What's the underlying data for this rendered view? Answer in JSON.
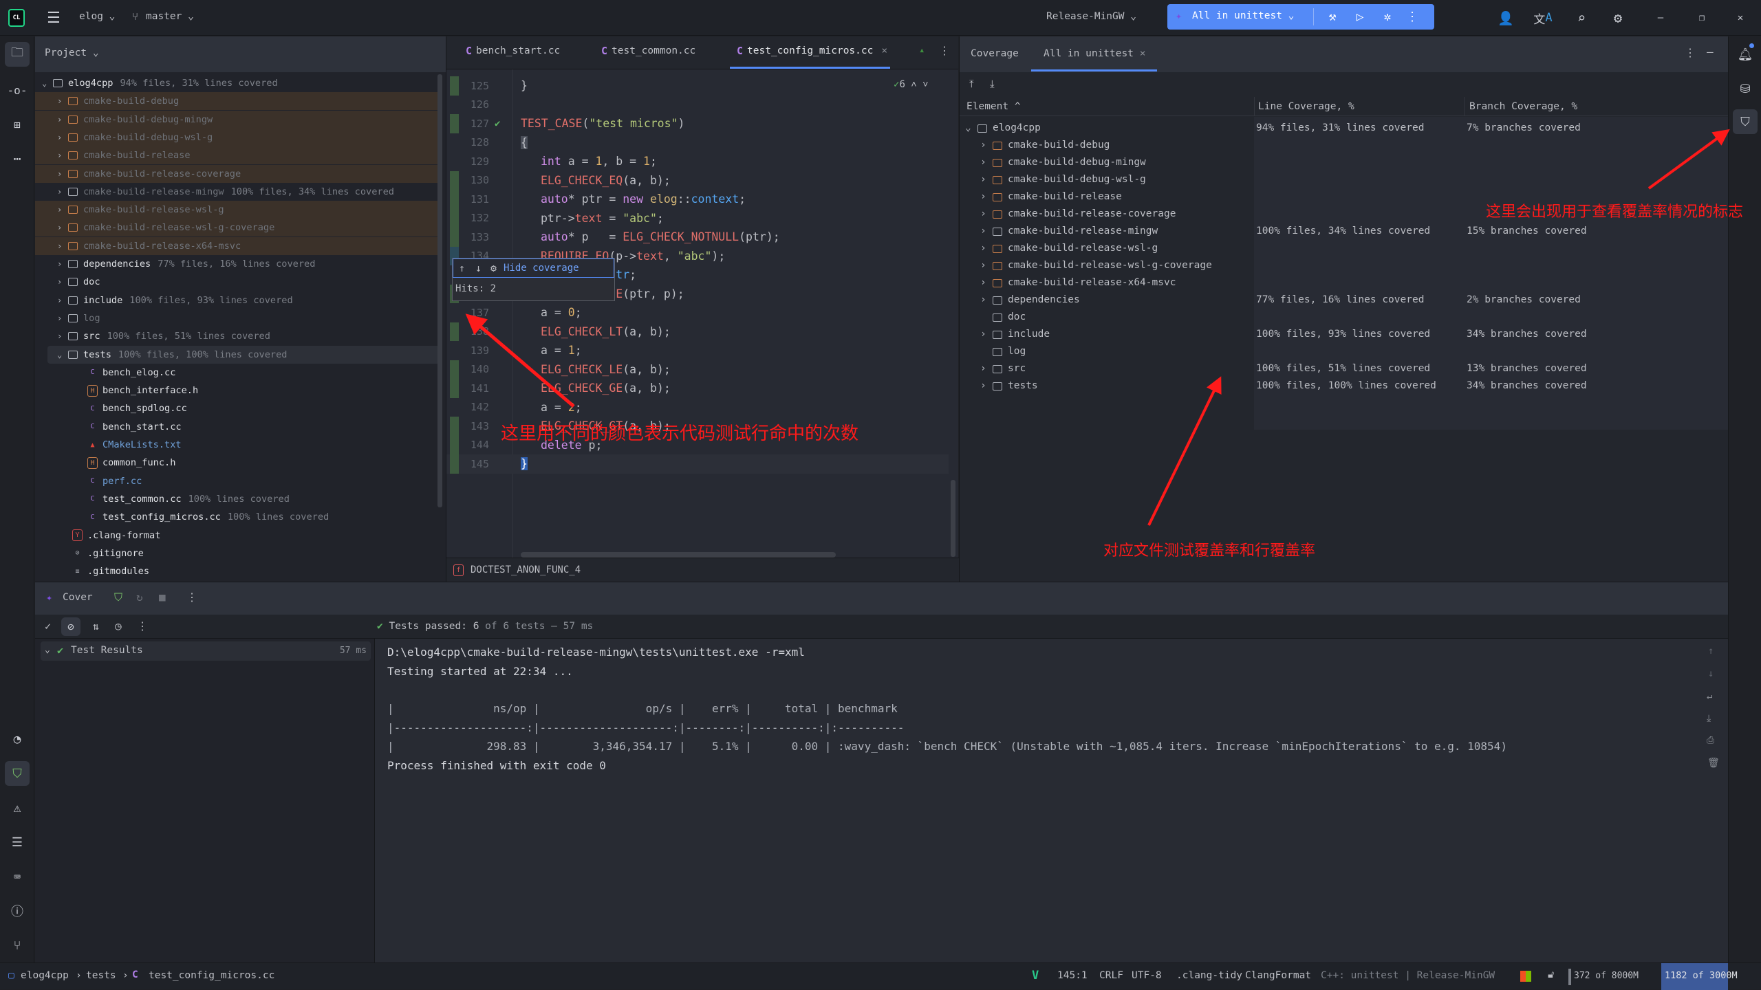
{
  "titlebar": {
    "project": "elog",
    "branch": "master",
    "config": "Release-MinGW",
    "run_config": "All in unittest"
  },
  "project_panel": {
    "title": "Project",
    "items": [
      {
        "name": "elog4cpp",
        "depth": 0,
        "type": "folder",
        "expanded": true,
        "note": "94% files, 31% lines covered"
      },
      {
        "name": "cmake-build-debug",
        "depth": 1,
        "type": "folder",
        "excluded": true
      },
      {
        "name": "cmake-build-debug-mingw",
        "depth": 1,
        "type": "folder",
        "excluded": true
      },
      {
        "name": "cmake-build-debug-wsl-g",
        "depth": 1,
        "type": "folder",
        "excluded": true
      },
      {
        "name": "cmake-build-release",
        "depth": 1,
        "type": "folder",
        "excluded": true
      },
      {
        "name": "cmake-build-release-coverage",
        "depth": 1,
        "type": "folder",
        "excluded": true
      },
      {
        "name": "cmake-build-release-mingw",
        "depth": 1,
        "type": "folder",
        "dim": true,
        "note": "100% files, 34% lines covered"
      },
      {
        "name": "cmake-build-release-wsl-g",
        "depth": 1,
        "type": "folder",
        "excluded": true
      },
      {
        "name": "cmake-build-release-wsl-g-coverage",
        "depth": 1,
        "type": "folder",
        "excluded": true
      },
      {
        "name": "cmake-build-release-x64-msvc",
        "depth": 1,
        "type": "folder",
        "excluded": true
      },
      {
        "name": "dependencies",
        "depth": 1,
        "type": "folder",
        "note": "77% files, 16% lines covered"
      },
      {
        "name": "doc",
        "depth": 1,
        "type": "folder"
      },
      {
        "name": "include",
        "depth": 1,
        "type": "folder",
        "note": "100% files, 93% lines covered"
      },
      {
        "name": "log",
        "depth": 1,
        "type": "folder",
        "dim": true
      },
      {
        "name": "src",
        "depth": 1,
        "type": "folder",
        "note": "100% files, 51% lines covered"
      },
      {
        "name": "tests",
        "depth": 1,
        "type": "folder",
        "expanded": true,
        "selected": true,
        "note": "100% files, 100% lines covered"
      },
      {
        "name": "bench_elog.cc",
        "depth": 2,
        "type": "cpp"
      },
      {
        "name": "bench_interface.h",
        "depth": 2,
        "type": "header"
      },
      {
        "name": "bench_spdlog.cc",
        "depth": 2,
        "type": "cpp"
      },
      {
        "name": "bench_start.cc",
        "depth": 2,
        "type": "cpp"
      },
      {
        "name": "CMakeLists.txt",
        "depth": 2,
        "type": "cmake",
        "link": true
      },
      {
        "name": "common_func.h",
        "depth": 2,
        "type": "header"
      },
      {
        "name": "perf.cc",
        "depth": 2,
        "type": "cpp",
        "link": true
      },
      {
        "name": "test_common.cc",
        "depth": 2,
        "type": "cpp",
        "note": "100% lines covered"
      },
      {
        "name": "test_config_micros.cc",
        "depth": 2,
        "type": "cpp",
        "note": "100% lines covered"
      },
      {
        "name": ".clang-format",
        "depth": 1,
        "type": "yaml"
      },
      {
        "name": ".gitignore",
        "depth": 1,
        "type": "ignore"
      },
      {
        "name": ".gitmodules",
        "depth": 1,
        "type": "text"
      }
    ]
  },
  "editor": {
    "tabs": [
      {
        "label": "bench_start.cc"
      },
      {
        "label": "test_common.cc"
      },
      {
        "label": "test_config_micros.cc",
        "active": true
      }
    ],
    "inspection_count": "6",
    "lines": [
      {
        "n": "125",
        "cov": "covered",
        "indent": 0,
        "tokens": [
          [
            "}",
            "p"
          ]
        ]
      },
      {
        "n": "126",
        "cov": null,
        "indent": 0,
        "tokens": []
      },
      {
        "n": "127",
        "cov": "covered",
        "indent": 0,
        "run_icon": true,
        "tokens": [
          [
            "TEST_CASE",
            "macro"
          ],
          [
            "(",
            "p"
          ],
          [
            "\"test micros\"",
            "str"
          ],
          [
            ")",
            "p"
          ]
        ]
      },
      {
        "n": "128",
        "cov": null,
        "indent": 0,
        "tokens": [
          [
            "{",
            "brace"
          ]
        ]
      },
      {
        "n": "129",
        "cov": null,
        "indent": 1,
        "tokens": [
          [
            "int",
            "kw"
          ],
          [
            " a = ",
            "p"
          ],
          [
            "1",
            "num"
          ],
          [
            ", b = ",
            "p"
          ],
          [
            "1",
            "num"
          ],
          [
            ";",
            "p"
          ]
        ]
      },
      {
        "n": "130",
        "cov": "covered",
        "indent": 1,
        "tokens": [
          [
            "ELG_CHECK_EQ",
            "macro"
          ],
          [
            "(a, b);",
            "p"
          ]
        ]
      },
      {
        "n": "131",
        "cov": "covered",
        "indent": 1,
        "tokens": [
          [
            "auto",
            "kw"
          ],
          [
            "* ptr = ",
            "p"
          ],
          [
            "new",
            "kw"
          ],
          [
            " ",
            "p"
          ],
          [
            "elog",
            "ns"
          ],
          [
            "::",
            "p"
          ],
          [
            "context",
            "type"
          ],
          [
            ";",
            "p"
          ]
        ]
      },
      {
        "n": "132",
        "cov": "covered",
        "indent": 1,
        "tokens": [
          [
            "ptr->",
            "p"
          ],
          [
            "text",
            "field"
          ],
          [
            " = ",
            "p"
          ],
          [
            "\"abc\"",
            "str"
          ],
          [
            ";",
            "p"
          ]
        ]
      },
      {
        "n": "133",
        "cov": "covered",
        "indent": 1,
        "tokens": [
          [
            "auto",
            "kw"
          ],
          [
            "* p   = ",
            "p"
          ],
          [
            "ELG_CHECK_NOTNULL",
            "macro"
          ],
          [
            "(ptr);",
            "p"
          ]
        ]
      },
      {
        "n": "134",
        "cov": "partial",
        "indent": 1,
        "tokens": [
          [
            "REQUIRE_EQ",
            "macro"
          ],
          [
            "(p->",
            "p"
          ],
          [
            "text",
            "field"
          ],
          [
            ", ",
            "p"
          ],
          [
            "\"abc\"",
            "str"
          ],
          [
            ");",
            "p"
          ]
        ]
      },
      {
        "n": "135",
        "cov": null,
        "indent": 1,
        "tokens": [
          [
            "           ",
            "p"
          ],
          [
            "tr",
            "type"
          ],
          [
            ";",
            "p"
          ]
        ]
      },
      {
        "n": "136",
        "cov": "covered",
        "indent": 1,
        "tokens": [
          [
            "           ",
            "p"
          ],
          [
            "E",
            "macro"
          ],
          [
            "(ptr, p);",
            "p"
          ]
        ]
      },
      {
        "n": "137",
        "cov": null,
        "indent": 1,
        "tokens": [
          [
            "a = ",
            "p"
          ],
          [
            "0",
            "num"
          ],
          [
            ";",
            "p"
          ]
        ]
      },
      {
        "n": "138",
        "cov": "covered",
        "indent": 1,
        "tokens": [
          [
            "ELG_CHECK_LT",
            "macro"
          ],
          [
            "(a, b);",
            "p"
          ]
        ]
      },
      {
        "n": "139",
        "cov": null,
        "indent": 1,
        "tokens": [
          [
            "a = ",
            "p"
          ],
          [
            "1",
            "num"
          ],
          [
            ";",
            "p"
          ]
        ]
      },
      {
        "n": "140",
        "cov": "covered",
        "indent": 1,
        "tokens": [
          [
            "ELG_CHECK_LE",
            "macro"
          ],
          [
            "(a, b);",
            "p"
          ]
        ]
      },
      {
        "n": "141",
        "cov": "covered",
        "indent": 1,
        "tokens": [
          [
            "ELG_CHECK_GE",
            "macro"
          ],
          [
            "(a, b);",
            "p"
          ]
        ]
      },
      {
        "n": "142",
        "cov": null,
        "indent": 1,
        "tokens": [
          [
            "a = ",
            "p"
          ],
          [
            "2",
            "num"
          ],
          [
            ";",
            "p"
          ]
        ]
      },
      {
        "n": "143",
        "cov": "covered",
        "indent": 1,
        "tokens": [
          [
            "ELG_CHECK_GT",
            "macro"
          ],
          [
            "(a, b);",
            "p"
          ]
        ]
      },
      {
        "n": "144",
        "cov": "covered",
        "indent": 1,
        "tokens": [
          [
            "delete",
            "kw"
          ],
          [
            " p;",
            "p"
          ]
        ]
      },
      {
        "n": "145",
        "cov": "covered",
        "indent": 0,
        "tokens": [
          [
            "}",
            "brace-sel"
          ]
        ]
      }
    ],
    "popup": {
      "action": "Hide coverage",
      "hits": "Hits: 2"
    },
    "breadcrumb_function": "DOCTEST_ANON_FUNC_4"
  },
  "coverage_panel": {
    "title": "Coverage",
    "tab": "All in unittest",
    "columns": [
      "Element ^",
      "Line Coverage, %",
      "Branch Coverage, %"
    ],
    "rows": [
      {
        "name": "elog4cpp",
        "depth": 0,
        "expanded": true,
        "line": "94% files, 31% lines covered",
        "branch": "7% branches covered"
      },
      {
        "name": "cmake-build-debug",
        "depth": 1,
        "orange": true,
        "line": "",
        "branch": ""
      },
      {
        "name": "cmake-build-debug-mingw",
        "depth": 1,
        "orange": true,
        "line": "",
        "branch": ""
      },
      {
        "name": "cmake-build-debug-wsl-g",
        "depth": 1,
        "orange": true,
        "line": "",
        "branch": ""
      },
      {
        "name": "cmake-build-release",
        "depth": 1,
        "orange": true,
        "line": "",
        "branch": ""
      },
      {
        "name": "cmake-build-release-coverage",
        "depth": 1,
        "orange": true,
        "line": "",
        "branch": ""
      },
      {
        "name": "cmake-build-release-mingw",
        "depth": 1,
        "line": "100% files, 34% lines covered",
        "branch": "15% branches covered"
      },
      {
        "name": "cmake-build-release-wsl-g",
        "depth": 1,
        "orange": true,
        "line": "",
        "branch": ""
      },
      {
        "name": "cmake-build-release-wsl-g-coverage",
        "depth": 1,
        "orange": true,
        "line": "",
        "branch": ""
      },
      {
        "name": "cmake-build-release-x64-msvc",
        "depth": 1,
        "orange": true,
        "line": "",
        "branch": ""
      },
      {
        "name": "dependencies",
        "depth": 1,
        "line": "77% files, 16% lines covered",
        "branch": "2% branches covered"
      },
      {
        "name": "doc",
        "depth": 1,
        "leaf": true,
        "line": "",
        "branch": ""
      },
      {
        "name": "include",
        "depth": 1,
        "line": "100% files, 93% lines covered",
        "branch": "34% branches covered"
      },
      {
        "name": "log",
        "depth": 1,
        "leaf": true,
        "line": "",
        "branch": ""
      },
      {
        "name": "src",
        "depth": 1,
        "line": "100% files, 51% lines covered",
        "branch": "13% branches covered"
      },
      {
        "name": "tests",
        "depth": 1,
        "line": "100% files, 100% lines covered",
        "branch": "34% branches covered"
      }
    ]
  },
  "run_panel": {
    "tab": "Cover",
    "status_prefix": "Tests passed: ",
    "status_count": "6",
    "status_suffix": " of 6 tests – 57 ms",
    "tree_root": "Test Results",
    "tree_time": "57 ms",
    "console": [
      "D:\\elog4cpp\\cmake-build-release-mingw\\tests\\unittest.exe -r=xml",
      "Testing started at 22:34 ...",
      "",
      "|               ns/op |                op/s |    err% |     total | benchmark",
      "|--------------------:|--------------------:|--------:|----------:|:----------",
      "|              298.83 |        3,346,354.17 |    5.1% |      0.00 | :wavy_dash: `bench CHECK` (Unstable with ~1,085.4 iters. Increase `minEpochIterations` to e.g. 10854)",
      "Process finished with exit code 0"
    ]
  },
  "statusbar": {
    "breadcrumb": [
      "elog4cpp",
      "tests",
      "test_config_micros.cc"
    ],
    "position": "145:1",
    "line_sep": "CRLF",
    "encoding": "UTF-8",
    "tidy": ".clang-tidy",
    "formatter": "ClangFormat",
    "context": "C++: unittest | Release-MinGW",
    "memory": "372 of 8000M",
    "memory2": "1182 of 3000M"
  },
  "annotations": {
    "editor_note": "这里用不同的颜色表示代码测试行命中的次数",
    "sidebar_note": "这里会出现用于查看覆盖率情况的标志",
    "table_note": "对应文件测试覆盖率和行覆盖率"
  },
  "colors": {
    "accent": "#548af7",
    "covered": "#3d5a3f",
    "partial": "#2c4b5b",
    "excluded_bg": "#3b3129",
    "annotation": "#ff1a1a"
  }
}
